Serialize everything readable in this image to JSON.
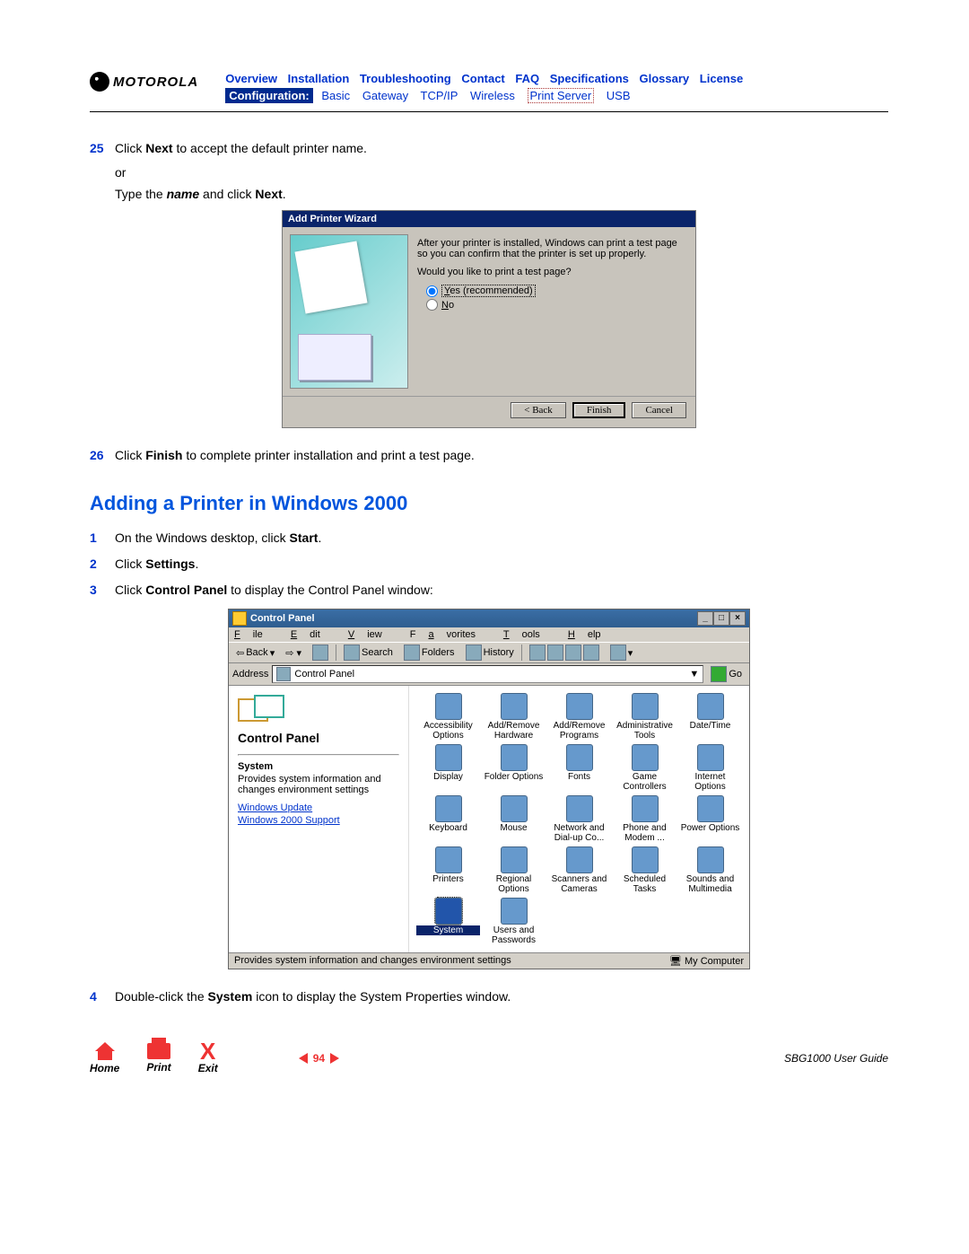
{
  "header": {
    "brand": "MOTOROLA",
    "nav1": [
      "Overview",
      "Installation",
      "Troubleshooting",
      "Contact",
      "FAQ",
      "Specifications",
      "Glossary",
      "License"
    ],
    "cfg_label": "Configuration:",
    "nav2": [
      "Basic",
      "Gateway",
      "TCP/IP",
      "Wireless",
      "Print Server",
      "USB"
    ],
    "nav2_active_index": 4
  },
  "steps_top": [
    {
      "num": "25",
      "body_parts": [
        "Click ",
        "Next",
        " to accept the default printer name."
      ]
    },
    {
      "sub": "or"
    },
    {
      "sub_parts": [
        "Type the ",
        "name",
        " and click ",
        "Next",
        "."
      ]
    }
  ],
  "wizard": {
    "title": "Add Printer Wizard",
    "line1": "After your printer is installed, Windows can print a test page so you can confirm that the printer is set up properly.",
    "line2": "Would you like to print a test page?",
    "opt_yes_pre": "Y",
    "opt_yes": "es (recommended)",
    "opt_no_pre": "N",
    "opt_no": "o",
    "btn_back_pre": "< ",
    "btn_back_u": "B",
    "btn_back": "ack",
    "btn_finish": "Finish",
    "btn_cancel": "Cancel"
  },
  "step26": {
    "num": "26",
    "pre": "Click ",
    "bold": "Finish",
    "post": " to complete printer installation and print a test page."
  },
  "section_heading": "Adding a Printer in Windows 2000",
  "steps_w2k": [
    {
      "num": "1",
      "pre": "On the Windows desktop, click ",
      "bold": "Start",
      "post": "."
    },
    {
      "num": "2",
      "pre": "Click ",
      "bold": "Settings",
      "post": "."
    },
    {
      "num": "3",
      "pre": "Click ",
      "bold": "Control Panel",
      "post": " to display the Control Panel window:"
    }
  ],
  "cp": {
    "title": "Control Panel",
    "menu_file_u": "F",
    "menu_file": "ile",
    "menu_edit_u": "E",
    "menu_edit": "dit",
    "menu_view_u": "V",
    "menu_view": "iew",
    "menu_fav_pre": "F",
    "menu_fav_u": "a",
    "menu_fav": "vorites",
    "menu_tools_u": "T",
    "menu_tools": "ools",
    "menu_help_u": "H",
    "menu_help": "elp",
    "tb_back": "Back",
    "tb_search": "Search",
    "tb_folders": "Folders",
    "tb_history": "History",
    "addr_label_pre": "A",
    "addr_label_u": "d",
    "addr_label": "dress",
    "addr_value": "Control Panel",
    "go": "Go",
    "side_title": "Control Panel",
    "side_sub": "System",
    "side_desc": "Provides system information and changes environment settings",
    "side_links": [
      "Windows Update",
      "Windows 2000 Support"
    ],
    "icons": [
      "Accessibility Options",
      "Add/Remove Hardware",
      "Add/Remove Programs",
      "Administrative Tools",
      "Date/Time",
      "Display",
      "Folder Options",
      "Fonts",
      "Game Controllers",
      "Internet Options",
      "Keyboard",
      "Mouse",
      "Network and Dial-up Co...",
      "Phone and Modem ...",
      "Power Options",
      "Printers",
      "Regional Options",
      "Scanners and Cameras",
      "Scheduled Tasks",
      "Sounds and Multimedia",
      "System",
      "Users and Passwords"
    ],
    "selected_index": 20,
    "status_left": "Provides system information and changes environment settings",
    "status_right": "My Computer"
  },
  "step4": {
    "num": "4",
    "pre": "Double-click the ",
    "bold": "System",
    "post": " icon to display the System Properties window."
  },
  "footer": {
    "home": "Home",
    "print": "Print",
    "exit": "Exit",
    "page": "94",
    "guide": "SBG1000 User Guide"
  }
}
